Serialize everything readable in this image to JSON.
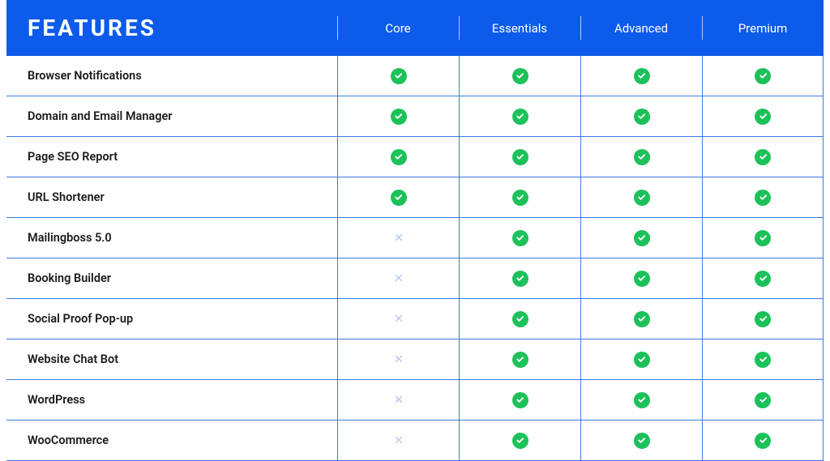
{
  "header": {
    "title": "FEATURES",
    "plans": [
      "Core",
      "Essentials",
      "Advanced",
      "Premium"
    ]
  },
  "features": [
    {
      "name": "Browser Notifications",
      "values": [
        true,
        true,
        true,
        true
      ]
    },
    {
      "name": "Domain and Email Manager",
      "values": [
        true,
        true,
        true,
        true
      ]
    },
    {
      "name": "Page SEO Report",
      "values": [
        true,
        true,
        true,
        true
      ]
    },
    {
      "name": "URL Shortener",
      "values": [
        true,
        true,
        true,
        true
      ]
    },
    {
      "name": "Mailingboss 5.0",
      "values": [
        false,
        true,
        true,
        true
      ]
    },
    {
      "name": "Booking Builder",
      "values": [
        false,
        true,
        true,
        true
      ]
    },
    {
      "name": "Social Proof Pop-up",
      "values": [
        false,
        true,
        true,
        true
      ]
    },
    {
      "name": "Website Chat Bot",
      "values": [
        false,
        true,
        true,
        true
      ]
    },
    {
      "name": "WordPress",
      "values": [
        false,
        true,
        true,
        true
      ]
    },
    {
      "name": "WooCommerce",
      "values": [
        false,
        true,
        true,
        true
      ]
    }
  ]
}
